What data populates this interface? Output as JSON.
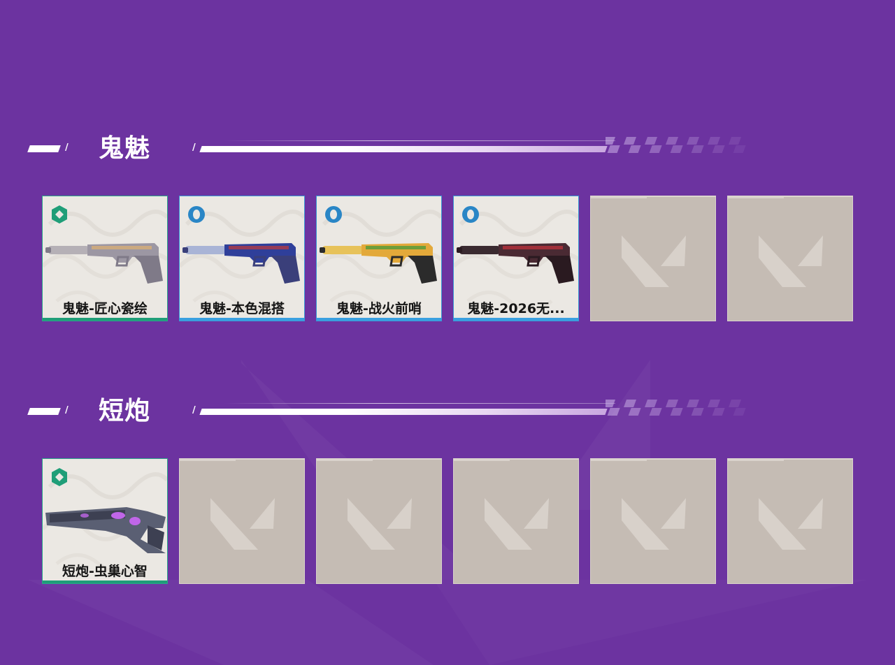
{
  "sections": [
    {
      "title": "鬼魅",
      "cards": [
        {
          "label": "鬼魅-匠心瓷绘",
          "rarity": "select",
          "weapon_style": "ghost-porcelain",
          "filled": true
        },
        {
          "label": "鬼魅-本色混搭",
          "rarity": "deluxe",
          "weapon_style": "ghost-mix",
          "filled": true
        },
        {
          "label": "鬼魅-战火前哨",
          "rarity": "deluxe",
          "weapon_style": "ghost-outpost",
          "filled": true
        },
        {
          "label": "鬼魅-2026无...",
          "rarity": "deluxe",
          "weapon_style": "ghost-2026",
          "filled": true
        },
        {
          "filled": false
        },
        {
          "filled": false
        }
      ]
    },
    {
      "title": "短炮",
      "cards": [
        {
          "label": "短炮-虫巢心智",
          "rarity": "select",
          "weapon_style": "shorty-hivemind",
          "filled": true
        },
        {
          "filled": false
        },
        {
          "filled": false
        },
        {
          "filled": false
        },
        {
          "filled": false
        },
        {
          "filled": false
        }
      ]
    }
  ],
  "colors": {
    "background": "#6c33a0",
    "select_tier": "#1f9e78",
    "deluxe_tier": "#3aa0e0",
    "empty_slot": "#c5bcb4"
  },
  "icons": {
    "select_tier": "select-tier-icon",
    "deluxe_tier": "deluxe-tier-icon",
    "empty_slot": "valorant-logo-icon"
  }
}
